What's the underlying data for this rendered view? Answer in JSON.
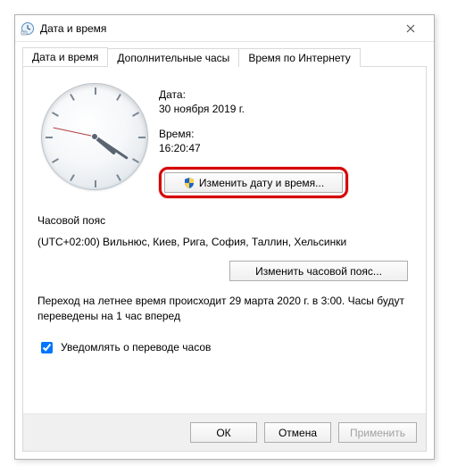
{
  "window": {
    "title": "Дата и время"
  },
  "tabs": {
    "t1": "Дата и время",
    "t2": "Дополнительные часы",
    "t3": "Время по Интернету"
  },
  "date": {
    "label": "Дата:",
    "value": "30 ноября 2019 г."
  },
  "time": {
    "label": "Время:",
    "value": "16:20:47"
  },
  "buttons": {
    "change_dt": "Изменить дату и время...",
    "change_tz": "Изменить часовой пояс...",
    "ok": "ОК",
    "cancel": "Отмена",
    "apply": "Применить"
  },
  "sections": {
    "tz_heading": "Часовой пояс",
    "tz_value": "(UTC+02:00) Вильнюс, Киев, Рига, София, Таллин, Хельсинки"
  },
  "dst": {
    "note": "Переход на летнее время происходит 29 марта 2020 г. в 3:00. Часы будут переведены на 1 час вперед",
    "checkbox_label": "Уведомлять о переводе часов",
    "checked": true
  }
}
